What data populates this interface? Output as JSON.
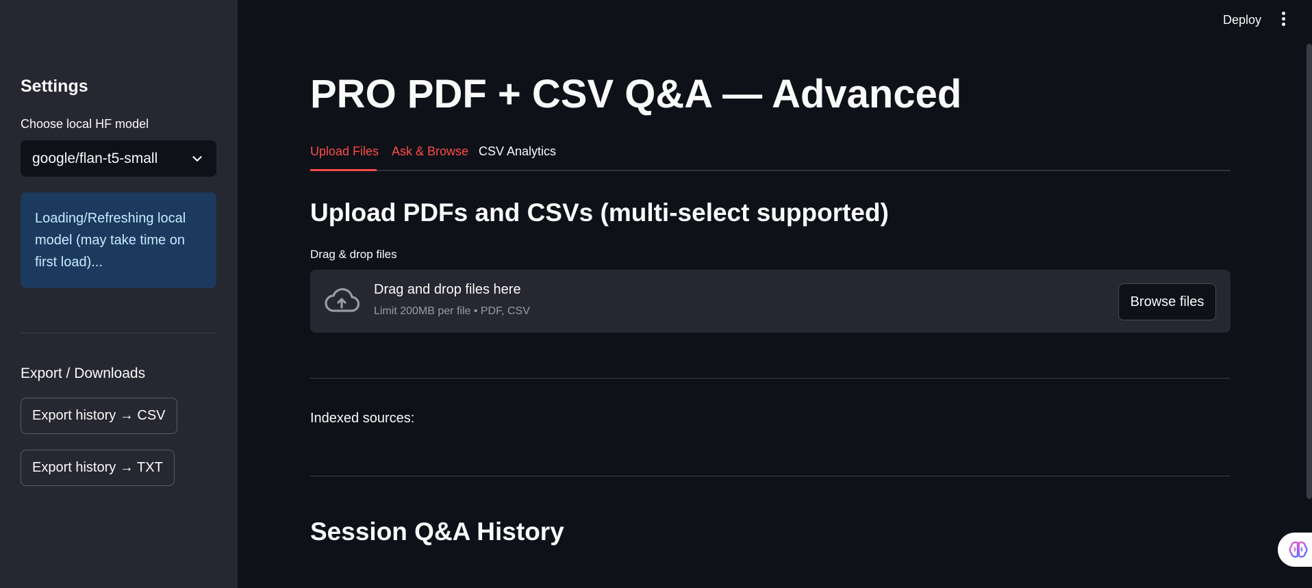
{
  "sidebar": {
    "title": "Settings",
    "model_label": "Choose local HF model",
    "model_value": "google/flan-t5-small",
    "info_text": "Loading/Refreshing local model (may take time on first load)...",
    "export_heading": "Export / Downloads",
    "export_csv_label": "Export history → CSV",
    "export_txt_label": "Export history → TXT"
  },
  "header": {
    "deploy_label": "Deploy"
  },
  "main": {
    "title": "PRO PDF + CSV Q&A — Advanced",
    "tabs": [
      {
        "label": "Upload Files",
        "active": true
      },
      {
        "label": "Ask & Browse",
        "active": false
      },
      {
        "label": "CSV Analytics",
        "active": false
      }
    ],
    "upload_heading": "Upload PDFs and CSVs (multi-select supported)",
    "uploader_label": "Drag & drop files",
    "dropzone_main": "Drag and drop files here",
    "dropzone_sub": "Limit 200MB per file • PDF, CSV",
    "browse_label": "Browse files",
    "indexed_label": "Indexed sources:",
    "history_heading": "Session Q&A History"
  },
  "colors": {
    "accent": "#ff4b4b",
    "background": "#0e1117",
    "sidebar_bg": "#262730",
    "info_bg": "#1c3a5e"
  },
  "icons": [
    "chevron-down-icon",
    "kebab-menu-icon",
    "cloud-upload-icon",
    "brain-icon"
  ]
}
